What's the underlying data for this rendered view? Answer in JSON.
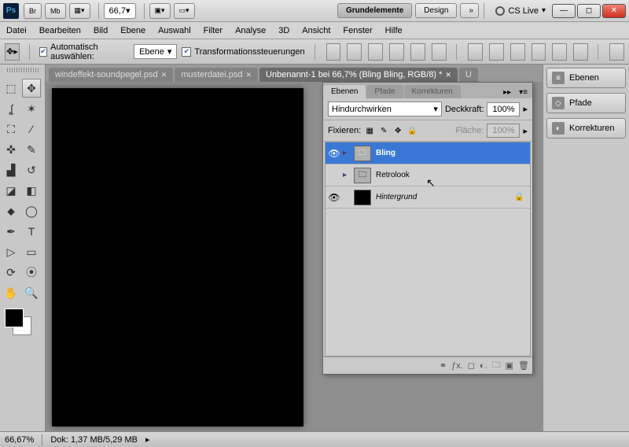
{
  "titlebar": {
    "app_icon": "Ps",
    "btn_br": "Br",
    "btn_mb": "Mb",
    "zoom": "66,7",
    "ws_active": "Grundelemente",
    "ws_next": "Design",
    "ws_more": "»",
    "cslive": "CS Live"
  },
  "menu": [
    "Datei",
    "Bearbeiten",
    "Bild",
    "Ebene",
    "Auswahl",
    "Filter",
    "Analyse",
    "3D",
    "Ansicht",
    "Fenster",
    "Hilfe"
  ],
  "options": {
    "auto_select": "Automatisch auswählen:",
    "target": "Ebene",
    "transform": "Transformationssteuerungen"
  },
  "docs": [
    {
      "name": "windeffekt-soundpegel.psd",
      "active": false
    },
    {
      "name": "musterdatei.psd",
      "active": false
    },
    {
      "name": "Unbenannt-1 bei 66,7% (Bling Bling, RGB/8) *",
      "active": true
    },
    {
      "name": "U",
      "active": false
    }
  ],
  "dock": {
    "layers": "Ebenen",
    "paths": "Pfade",
    "corrections": "Korrekturen"
  },
  "panel": {
    "tabs": [
      "Ebenen",
      "Pfade",
      "Korrekturen"
    ],
    "blend_mode": "Hindurchwirken",
    "opacity_label": "Deckkraft:",
    "opacity": "100%",
    "lock_label": "Fixieren:",
    "fill_label": "Fläche:",
    "fill": "100%",
    "layers": [
      {
        "name": "Bling",
        "type": "folder",
        "selected": true,
        "visible": true
      },
      {
        "name": "Retrolook",
        "type": "folder",
        "selected": false,
        "visible": false
      },
      {
        "name": "Hintergrund",
        "type": "bg",
        "selected": false,
        "visible": true,
        "locked": true
      }
    ]
  },
  "status": {
    "zoom": "66,67%",
    "doc": "Dok: 1,37 MB/5,29 MB"
  }
}
